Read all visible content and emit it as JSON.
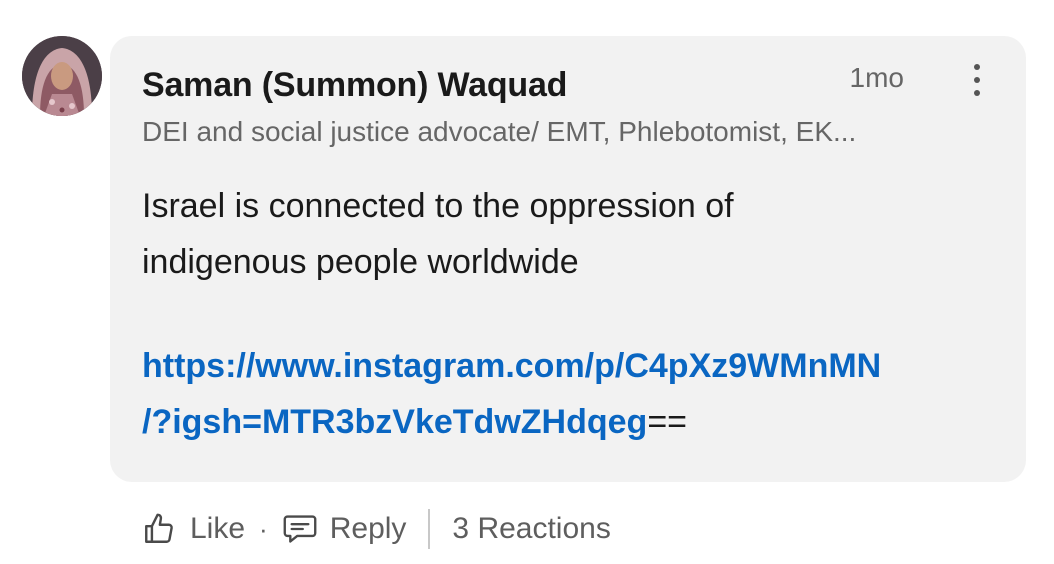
{
  "comment": {
    "author": {
      "name": "Saman (Summon) Waquad",
      "headline": "DEI and social justice advocate/ EMT, Phlebotomist, EK..."
    },
    "timestamp": "1mo",
    "body_lines": [
      "Israel is connected to the oppression of",
      "indigenous people worldwide"
    ],
    "link": {
      "line1": "https://www.instagram.com/p/C4pXz9WMnMN",
      "line2": "/?igsh=MTR3bzVkeTdwZHdqeg",
      "suffix": "=="
    }
  },
  "actions": {
    "like_label": "Like",
    "separator": "·",
    "reply_label": "Reply",
    "reactions_label": "3 Reactions"
  },
  "colors": {
    "bubble": "#f2f2f2",
    "link": "#0a66c2",
    "text": "#1a1a1a",
    "muted": "#666666"
  },
  "icons": {
    "like": "thumbs-up-icon",
    "reply": "speech-bubble-icon",
    "more": "vertical-ellipsis-icon"
  }
}
